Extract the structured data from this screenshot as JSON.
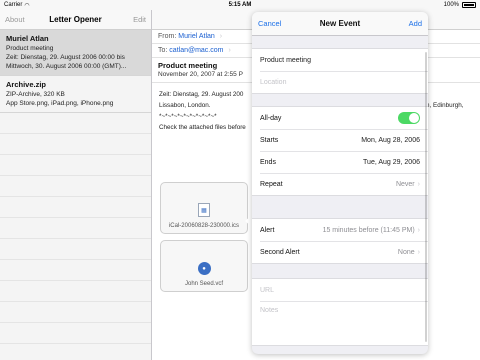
{
  "status": {
    "carrier": "Carrier",
    "time": "5:15 AM",
    "battery": "100%"
  },
  "left": {
    "about": "About",
    "title": "Letter Opener",
    "edit": "Edit",
    "messages": [
      {
        "sender": "Muriel Atlan",
        "line1": "Product meeting",
        "line2": "Zeit: Dienstag, 29. August 2006 00:00 bis",
        "line3": "Mittwoch, 30. August 2006 00:00 (GMT)..."
      },
      {
        "sender": "Archive.zip",
        "line1": "ZIP-Archive, 320 KB",
        "line2": "App Store.png, iPad.png, iPhone.png"
      }
    ]
  },
  "detail": {
    "from_label": "From:",
    "from_name": "Muriel Atlan",
    "to_label": "To:",
    "to_addr": "catlan@mac.com",
    "subject": "Product meeting",
    "date": "November 20, 2007 at 2:55 P",
    "body_line1": "Zeit: Dienstag, 29. August 200",
    "body_line1_tail": "n, Edinburgh,",
    "body_line2": "Lissabon, London.",
    "body_line3": "*~*~*~*~*~*~*~*~*~*",
    "body_line4": "Check the attached files before",
    "attachment1": "iCal-20060828-230000.ics",
    "attachment2": "John Seed.vcf"
  },
  "event": {
    "cancel": "Cancel",
    "title": "New Event",
    "add": "Add",
    "event_title": "Product meeting",
    "location_placeholder": "Location",
    "allday_label": "All-day",
    "allday_on": true,
    "starts_label": "Starts",
    "starts_value": "Mon, Aug 28, 2006",
    "ends_label": "Ends",
    "ends_value": "Tue, Aug 29, 2006",
    "repeat_label": "Repeat",
    "repeat_value": "Never",
    "alert_label": "Alert",
    "alert_value": "15 minutes before (11:45 PM)",
    "second_alert_label": "Second Alert",
    "second_alert_value": "None",
    "url_placeholder": "URL",
    "notes_placeholder": "Notes"
  },
  "colors": {
    "accent": "#1a6fe8",
    "toggle_on": "#4cd964"
  }
}
